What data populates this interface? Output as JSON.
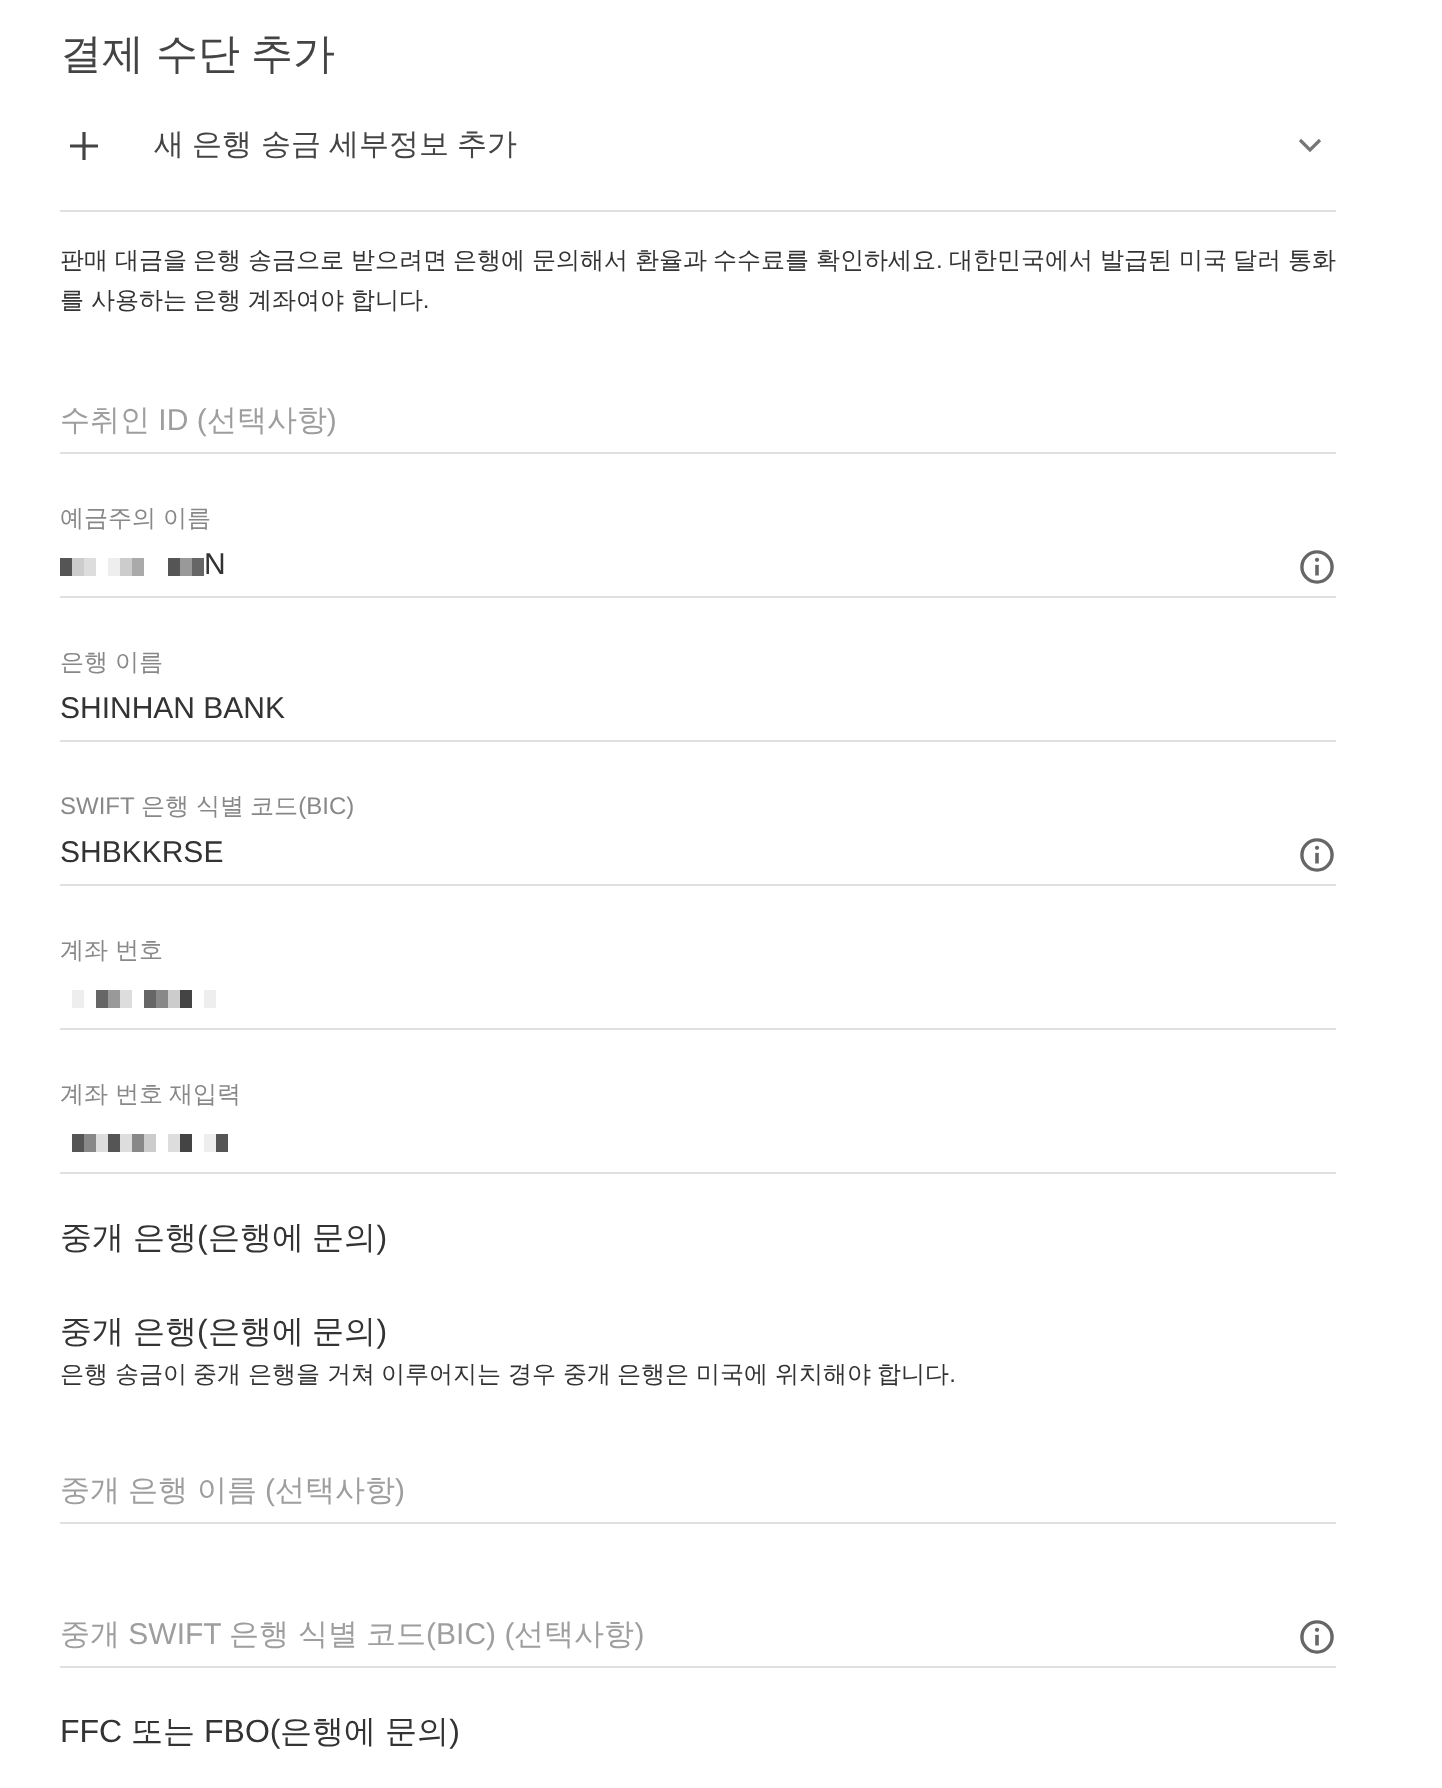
{
  "title": "결제 수단 추가",
  "expander": {
    "label": "새 은행 송금 세부정보 추가"
  },
  "items": [
    {
      "kind": "notice",
      "text": "판매 대금을 은행 송금으로 받으려면 은행에 문의해서 환율과 수수료를 확인하세요. 대한민국에서 발급된 미국 달러 통화를 사용하는 은행 계좌여야 합니다."
    },
    {
      "kind": "field",
      "placeholder": "수취인 ID (선택사항)",
      "redacted": false,
      "info": false
    },
    {
      "kind": "field",
      "label": "예금주의 이름",
      "value": "N",
      "redacted": true,
      "info": true
    },
    {
      "kind": "field",
      "label": "은행 이름",
      "value": "SHINHAN BANK",
      "redacted": false,
      "info": false
    },
    {
      "kind": "field",
      "label": "SWIFT 은행 식별 코드(BIC)",
      "value": "SHBKKRSE",
      "redacted": false,
      "info": true
    },
    {
      "kind": "field",
      "label": "계좌 번호",
      "redacted": true,
      "info": false
    },
    {
      "kind": "field",
      "label": "계좌 번호 재입력",
      "redacted": true,
      "info": false
    },
    {
      "kind": "heading",
      "text": "중개 은행(은행에 문의)"
    },
    {
      "kind": "heading",
      "text": "중개 은행(은행에 문의)",
      "note": "은행 송금이 중개 은행을 거쳐 이루어지는 경우 중개 은행은 미국에 위치해야 합니다."
    },
    {
      "kind": "field",
      "placeholder": "중개 은행 이름 (선택사항)",
      "redacted": false,
      "info": false
    },
    {
      "kind": "field",
      "placeholder": "중개 SWIFT 은행 식별 코드(BIC) (선택사항)",
      "redacted": false,
      "info": true
    },
    {
      "kind": "heading",
      "text": "FFC 또는 FBO(은행에 문의)"
    }
  ]
}
